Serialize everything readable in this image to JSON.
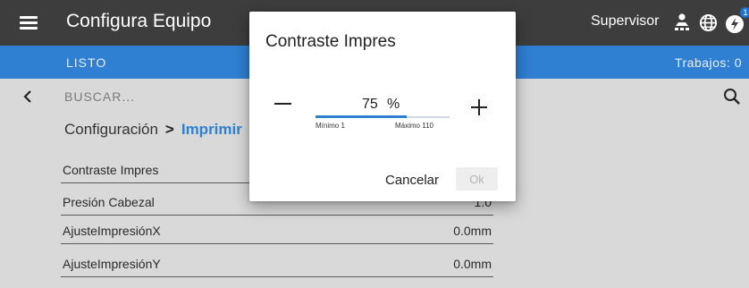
{
  "header": {
    "title": "Configura Equipo",
    "user_label": "Supervisor",
    "alert_badge": "1",
    "icons": [
      "menu-icon",
      "supervisor-icon",
      "globe-icon",
      "alert-icon"
    ]
  },
  "status": {
    "state": "LISTO",
    "jobs": "Trabajos: 0"
  },
  "search": {
    "placeholder": "BUSCAR..."
  },
  "breadcrumb": {
    "parent": "Configuración",
    "separator": ">",
    "current": "Imprimir"
  },
  "settings": [
    {
      "label": "Contraste Impres",
      "value": ""
    },
    {
      "label": "Presión Cabezal",
      "value": "1.0"
    },
    {
      "label": "AjusteImpresiónX",
      "value": "0.0mm"
    },
    {
      "label": "AjusteImpresiónY",
      "value": "0.0mm"
    }
  ],
  "dialog": {
    "title": "Contraste Impres",
    "value": 75,
    "unit": "%",
    "min": 1,
    "max": 110,
    "min_label": "Mínimo 1",
    "max_label": "Máximo 110",
    "cancel_label": "Cancelar",
    "ok_label": "Ok"
  },
  "colors": {
    "topbar": "#3d3d3d",
    "accent": "#2f7fd3",
    "background": "#d9d9d9",
    "dialog": "#ffffff"
  }
}
